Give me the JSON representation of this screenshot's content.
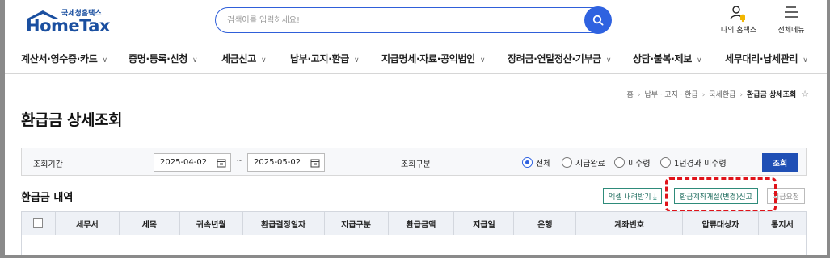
{
  "header": {
    "logo_small": "국세청홈택스",
    "logo_big": "HomeTax",
    "search": {
      "placeholder": "검색어를 입력하세요!"
    },
    "my_hometax": "나의 홈택스",
    "all_menu": "전체메뉴"
  },
  "nav": {
    "items": [
      "계산서·영수증·카드",
      "증명·등록·신청",
      "세금신고",
      "납부·고지·환급",
      "지급명세·자료·공익법인",
      "장려금·연말정산·기부금",
      "상담·불복·제보",
      "세무대리·납세관리"
    ]
  },
  "breadcrumb": {
    "items": [
      "홈",
      "납부ㆍ고지ㆍ환급",
      "국세환급"
    ],
    "current": "환급금 상세조회"
  },
  "page_title": "환급금 상세조회",
  "filter": {
    "period_label": "조회기간",
    "date_from": "2025-04-02",
    "date_to": "2025-05-02",
    "tilde": "~",
    "type_label": "조회구분",
    "radios": [
      "전체",
      "지급완료",
      "미수령",
      "1년경과 미수령"
    ],
    "selected": "전체",
    "query_button": "조회"
  },
  "section": {
    "title": "환급금 내역",
    "excel_button": "엑셀 내려받기",
    "account_button": "환급계좌개설(변경)신고",
    "request_button": "지급요청"
  },
  "table": {
    "columns": [
      "세무서",
      "세목",
      "귀속년월",
      "환급결정일자",
      "지급구분",
      "환급금액",
      "지급일",
      "은행",
      "계좌번호",
      "압류대상자",
      "통지서"
    ]
  },
  "colors": {
    "primary": "#2f62e0",
    "query_button": "#1f4fb5",
    "highlight": "#e0131a",
    "outline_button": "#2e8b7a"
  }
}
